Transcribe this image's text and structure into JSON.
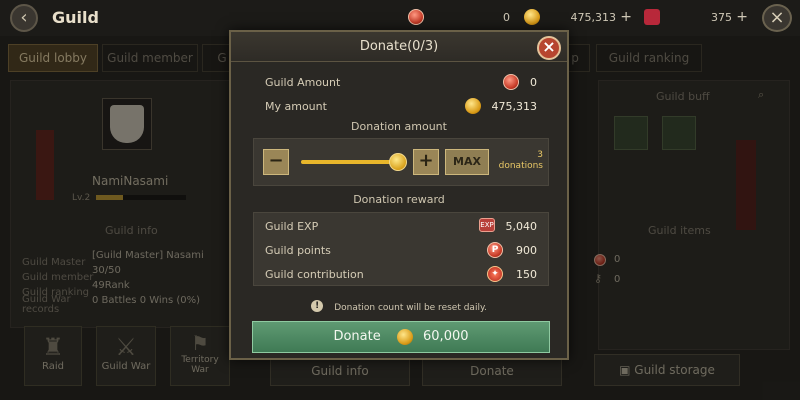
{
  "header": {
    "back_icon": "back-arrow-icon",
    "title": "Guild",
    "currency_points": "0",
    "currency_gold": "475,313",
    "currency_gems": "375",
    "plus": "+"
  },
  "tabs": [
    {
      "label": "Guild lobby",
      "active": true
    },
    {
      "label": "Guild member"
    },
    {
      "label": "G"
    },
    {
      "label": "p"
    },
    {
      "label": "Guild ranking"
    }
  ],
  "lobby": {
    "guild_name": "NamiNasami",
    "level": "Lv.2",
    "guild_info_title": "Guild info",
    "info_rows": [
      {
        "label": "Guild Master",
        "value": "[Guild Master] Nasami"
      },
      {
        "label": "Guild member",
        "value": "30/50"
      },
      {
        "label": "Guild ranking",
        "value": "49Rank"
      },
      {
        "label": "Guild War records",
        "value": "0 Battles 0 Wins (0%)"
      }
    ],
    "guild_buff_title": "Guild buff",
    "guild_items_title": "Guild items",
    "items_counts": [
      "0",
      "0"
    ],
    "bottom_buttons": {
      "raid": "Raid",
      "guild_war": "Guild War",
      "territory_war": "Territory War",
      "guild_info": "Guild info",
      "donate": "Donate",
      "guild_storage": "Guild storage"
    }
  },
  "modal": {
    "title": "Donate(0/3)",
    "guild_amount_label": "Guild Amount",
    "guild_amount_value": "0",
    "my_amount_label": "My amount",
    "my_amount_value": "475,313",
    "donation_amount_title": "Donation amount",
    "minus_label": "−",
    "plus_label": "+",
    "max_label": "MAX",
    "slider_level": 1.0,
    "donations_count": "3",
    "donations_label": "donations",
    "reward_title": "Donation reward",
    "rewards": [
      {
        "label": "Guild EXP",
        "value": "5,040",
        "icon": "exp-icon"
      },
      {
        "label": "Guild points",
        "value": "900",
        "icon": "points-icon"
      },
      {
        "label": "Guild contribution",
        "value": "150",
        "icon": "contribution-icon"
      }
    ],
    "notice": "Donation count will be reset daily.",
    "donate_label": "Donate",
    "donate_cost": "60,000"
  }
}
